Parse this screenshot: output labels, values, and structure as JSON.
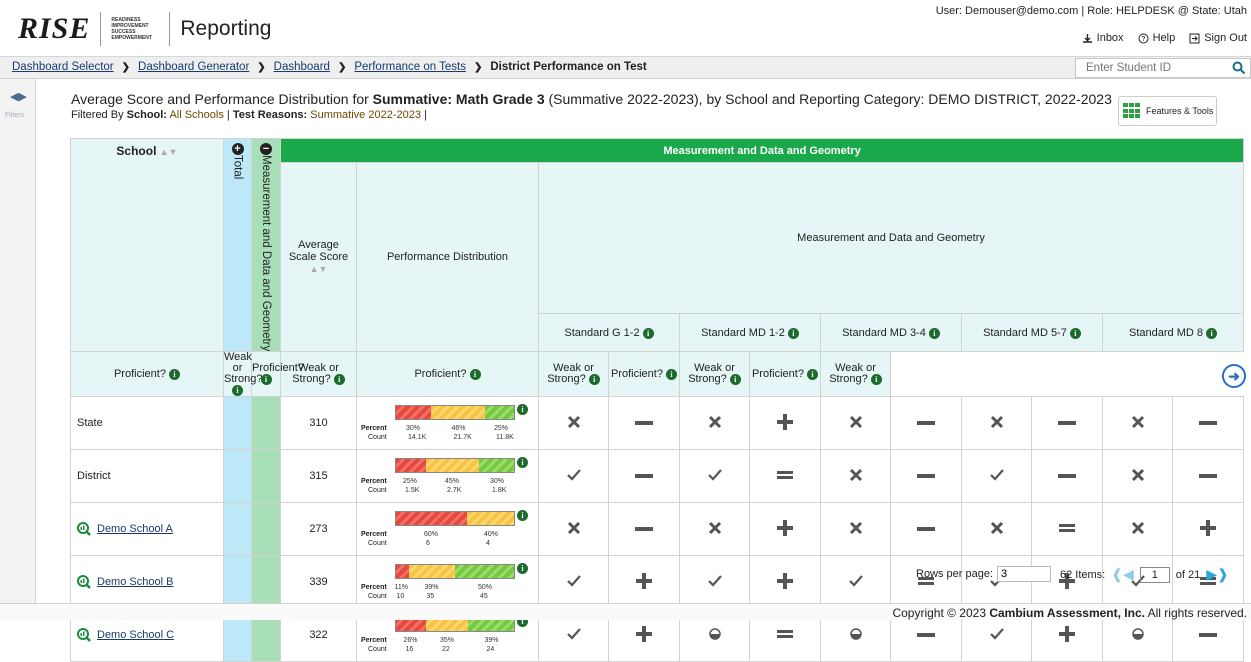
{
  "app": {
    "logo_text": "RISE",
    "logo_tagline": "READINESS IMPROVEMENT SUCCESS EMPOWERMENT",
    "title": "Reporting"
  },
  "user": {
    "line": "User: Demouser@demo.com  |  Role: HELPDESK @ State: Utah",
    "inbox": "Inbox",
    "help": "Help",
    "signout": "Sign Out"
  },
  "breadcrumbs": [
    "Dashboard Selector",
    "Dashboard Generator",
    "Dashboard",
    "Performance on Tests"
  ],
  "breadcrumb_current": "District Performance on Test",
  "student_search": {
    "placeholder": "Enter Student ID"
  },
  "sidebar": {
    "label": "Filters"
  },
  "page": {
    "title_prefix": "Average Score and Performance Distribution for ",
    "title_test": "Summative: Math Grade 3",
    "title_suffix": " (Summative 2022-2023), by School and Reporting Category: DEMO DISTRICT, 2022-2023",
    "filter_label": "Filtered By ",
    "filter_school_label": "School:",
    "filter_school_value": "All Schools",
    "filter_sep": "  |  ",
    "filter_reason_label": "Test Reasons:",
    "filter_reason_value": "Summative 2022-2023",
    "filter_end": "  |"
  },
  "features_button": "Features & Tools",
  "table": {
    "school_header": "School",
    "total_label": "Total",
    "mdg_label": "Measurement and Data and Geometry",
    "group_header": "Measurement and Data and Geometry",
    "subgroup_header": "Measurement and Data and Geometry",
    "avg_header": "Average Scale Score",
    "dist_header": "Performance Distribution",
    "standards": [
      "Standard G 1-2",
      "Standard MD 1-2",
      "Standard MD 3-4",
      "Standard MD 5-7",
      "Standard MD 8"
    ],
    "prof_label": "Proficient?",
    "weak_label": "Weak or Strong?",
    "percent_label": "Percent",
    "count_label": "Count",
    "rows": [
      {
        "name": "State",
        "link": false,
        "score": "310",
        "pct": [
          30,
          46,
          25
        ],
        "pct_text": [
          "30%",
          "46%",
          "25%"
        ],
        "cnt_text": [
          "14.1K",
          "21.7K",
          "11.8K"
        ],
        "marks": [
          "x",
          "minus",
          "x",
          "plus",
          "x",
          "minus",
          "x",
          "minus",
          "x",
          "minus"
        ]
      },
      {
        "name": "District",
        "link": false,
        "score": "315",
        "pct": [
          25,
          45,
          30
        ],
        "pct_text": [
          "25%",
          "45%",
          "30%"
        ],
        "cnt_text": [
          "1.5K",
          "2.7K",
          "1.8K"
        ],
        "marks": [
          "check",
          "minus",
          "check",
          "equal",
          "x",
          "minus",
          "check",
          "minus",
          "x",
          "minus"
        ]
      },
      {
        "name": "Demo School A",
        "link": true,
        "score": "273",
        "pct": [
          60,
          40,
          0
        ],
        "pct_text": [
          "60%",
          "40%",
          ""
        ],
        "cnt_text": [
          "6",
          "4",
          ""
        ],
        "marks": [
          "x",
          "minus",
          "x",
          "plus",
          "x",
          "minus",
          "x",
          "equal",
          "x",
          "plus"
        ]
      },
      {
        "name": "Demo School B",
        "link": true,
        "score": "339",
        "pct": [
          11,
          39,
          50
        ],
        "pct_text": [
          "11%",
          "39%",
          "50%"
        ],
        "cnt_text": [
          "10",
          "35",
          "45"
        ],
        "marks": [
          "check",
          "plus",
          "check",
          "plus",
          "check",
          "equal",
          "check",
          "plus",
          "check",
          "equal"
        ]
      },
      {
        "name": "Demo School C",
        "link": true,
        "score": "322",
        "pct": [
          26,
          35,
          39
        ],
        "pct_text": [
          "26%",
          "35%",
          "39%"
        ],
        "cnt_text": [
          "16",
          "22",
          "24"
        ],
        "marks": [
          "check",
          "plus",
          "half",
          "equal",
          "half",
          "minus",
          "check",
          "plus",
          "half",
          "minus"
        ]
      }
    ]
  },
  "pager": {
    "rows_label": "Rows per page:",
    "rows_value": "3",
    "items": "62 Items:",
    "page": "1",
    "of": "of 21"
  },
  "footer": {
    "prefix": "Copyright © 2023 ",
    "company": "Cambium Assessment, Inc.",
    "suffix": " All rights reserved."
  }
}
